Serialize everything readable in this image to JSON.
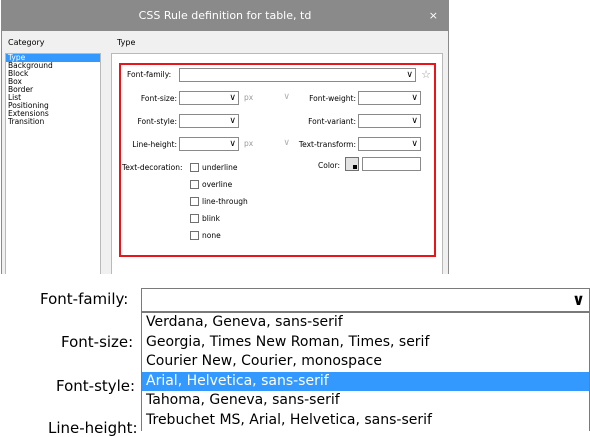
{
  "dialog": {
    "title": "CSS Rule definition for table, td",
    "close_glyph": "×",
    "category_heading": "Category",
    "pane_heading": "Type",
    "categories": [
      {
        "label": "Type",
        "selected": true
      },
      {
        "label": "Background",
        "selected": false
      },
      {
        "label": "Block",
        "selected": false
      },
      {
        "label": "Box",
        "selected": false
      },
      {
        "label": "Border",
        "selected": false
      },
      {
        "label": "List",
        "selected": false
      },
      {
        "label": "Positioning",
        "selected": false
      },
      {
        "label": "Extensions",
        "selected": false
      },
      {
        "label": "Transition",
        "selected": false
      }
    ],
    "fields": {
      "font_family": "Font-family:",
      "font_size": "Font-size:",
      "font_style": "Font-style:",
      "line_height": "Line-height:",
      "font_weight": "Font-weight:",
      "font_variant": "Font-variant:",
      "text_transform": "Text-transform:",
      "text_decoration": "Text-decoration:",
      "color": "Color:",
      "unit_px": "px",
      "chevron": "∨"
    },
    "decorations": [
      "underline",
      "overline",
      "line-through",
      "blink",
      "none"
    ],
    "highlight_color": "#e8151b"
  },
  "zoom": {
    "font_family": "Font-family:",
    "font_size": "Font-size:",
    "font_style": "Font-style:",
    "line_height": "Line-height:",
    "chevron": "∨",
    "options": [
      {
        "label": "Verdana, Geneva, sans-serif",
        "highlighted": false
      },
      {
        "label": "Georgia, Times New Roman, Times, serif",
        "highlighted": false
      },
      {
        "label": "Courier New, Courier, monospace",
        "highlighted": false
      },
      {
        "label": "Arial, Helvetica, sans-serif",
        "highlighted": true
      },
      {
        "label": "Tahoma, Geneva, sans-serif",
        "highlighted": false
      },
      {
        "label": "Trebuchet MS, Arial, Helvetica, sans-serif",
        "highlighted": false
      }
    ]
  }
}
